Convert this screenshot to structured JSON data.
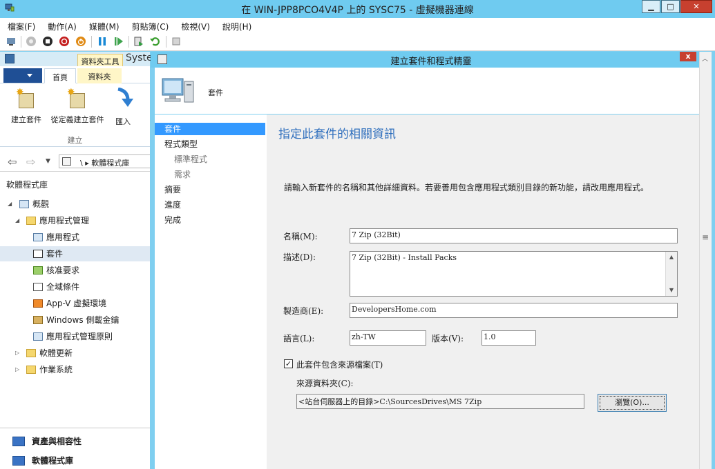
{
  "window": {
    "title": "在 WIN-JPP8PCO4V4P 上的 SYSC75 - 虛擬機器連線",
    "min_glyph": "▁",
    "max_glyph": "□",
    "close_glyph": "✕"
  },
  "menu": [
    "檔案(F)",
    "動作(A)",
    "媒體(M)",
    "剪貼簿(C)",
    "檢視(V)",
    "說明(H)"
  ],
  "console": {
    "context_tab": "資料夾工具",
    "title_fragment": "Syste",
    "tabs": {
      "home": "首頁",
      "folder": "資料夾"
    },
    "ribbon_buttons": [
      "建立套件",
      "從定義建立套件",
      "匯入"
    ],
    "group_label": "建立",
    "nav_path": "\\ ▸ 軟體程式庫",
    "section_title": "軟體程式庫",
    "tree": [
      {
        "label": "概觀",
        "level": 0,
        "expander": "◢",
        "icon": "overview-icon"
      },
      {
        "label": "應用程式管理",
        "level": 1,
        "expander": "◢",
        "icon": "folder-icon"
      },
      {
        "label": "應用程式",
        "level": 2,
        "expander": "",
        "icon": "application-icon"
      },
      {
        "label": "套件",
        "level": 2,
        "expander": "",
        "icon": "package-icon",
        "selected": true
      },
      {
        "label": "核准要求",
        "level": 2,
        "expander": "",
        "icon": "approval-icon"
      },
      {
        "label": "全域條件",
        "level": 2,
        "expander": "",
        "icon": "global-condition-icon"
      },
      {
        "label": "App-V 虛擬環境",
        "level": 2,
        "expander": "",
        "icon": "appv-icon"
      },
      {
        "label": "Windows 側載金鑰",
        "level": 2,
        "expander": "",
        "icon": "key-icon"
      },
      {
        "label": "應用程式管理原則",
        "level": 2,
        "expander": "",
        "icon": "policy-icon"
      },
      {
        "label": "軟體更新",
        "level": 1,
        "expander": "▷",
        "icon": "folder-icon"
      },
      {
        "label": "作業系統",
        "level": 1,
        "expander": "▷",
        "icon": "folder-icon"
      }
    ],
    "bottom_nav": [
      "資產與相容性",
      "軟體程式庫"
    ]
  },
  "wizard": {
    "title": "建立套件和程式精靈",
    "header_label": "套件",
    "close_glyph": "x",
    "steps": [
      {
        "label": "套件",
        "active": true,
        "sub": false
      },
      {
        "label": "程式類型",
        "active": false,
        "sub": false
      },
      {
        "label": "標準程式",
        "active": false,
        "sub": true
      },
      {
        "label": "需求",
        "active": false,
        "sub": true
      },
      {
        "label": "摘要",
        "active": false,
        "sub": false
      },
      {
        "label": "進度",
        "active": false,
        "sub": false
      },
      {
        "label": "完成",
        "active": false,
        "sub": false
      }
    ],
    "page_title": "指定此套件的相關資訊",
    "instruction": "請輸入新套件的名稱和其他詳細資料。若要善用包含應用程式類別目錄的新功能，請改用應用程式。",
    "fields": {
      "name_label": "名稱(M):",
      "name_value": "7 Zip (32Bit)",
      "description_label": "描述(D):",
      "description_value": "7 Zip (32Bit) - Install Packs",
      "manufacturer_label": "製造商(E):",
      "manufacturer_value": "DevelopersHome.com",
      "language_label": "語言(L):",
      "language_value": "zh-TW",
      "version_label": "版本(V):",
      "version_value": "1.0",
      "source_checkbox_label": "此套件包含來源檔案(T)",
      "source_checkbox_checked": true,
      "source_folder_label": "來源資料夾(C):",
      "source_folder_value": "<站台伺服器上的目錄>C:\\SourcesDrives\\MS 7Zip",
      "browse_label": "瀏覽(O)..."
    }
  }
}
